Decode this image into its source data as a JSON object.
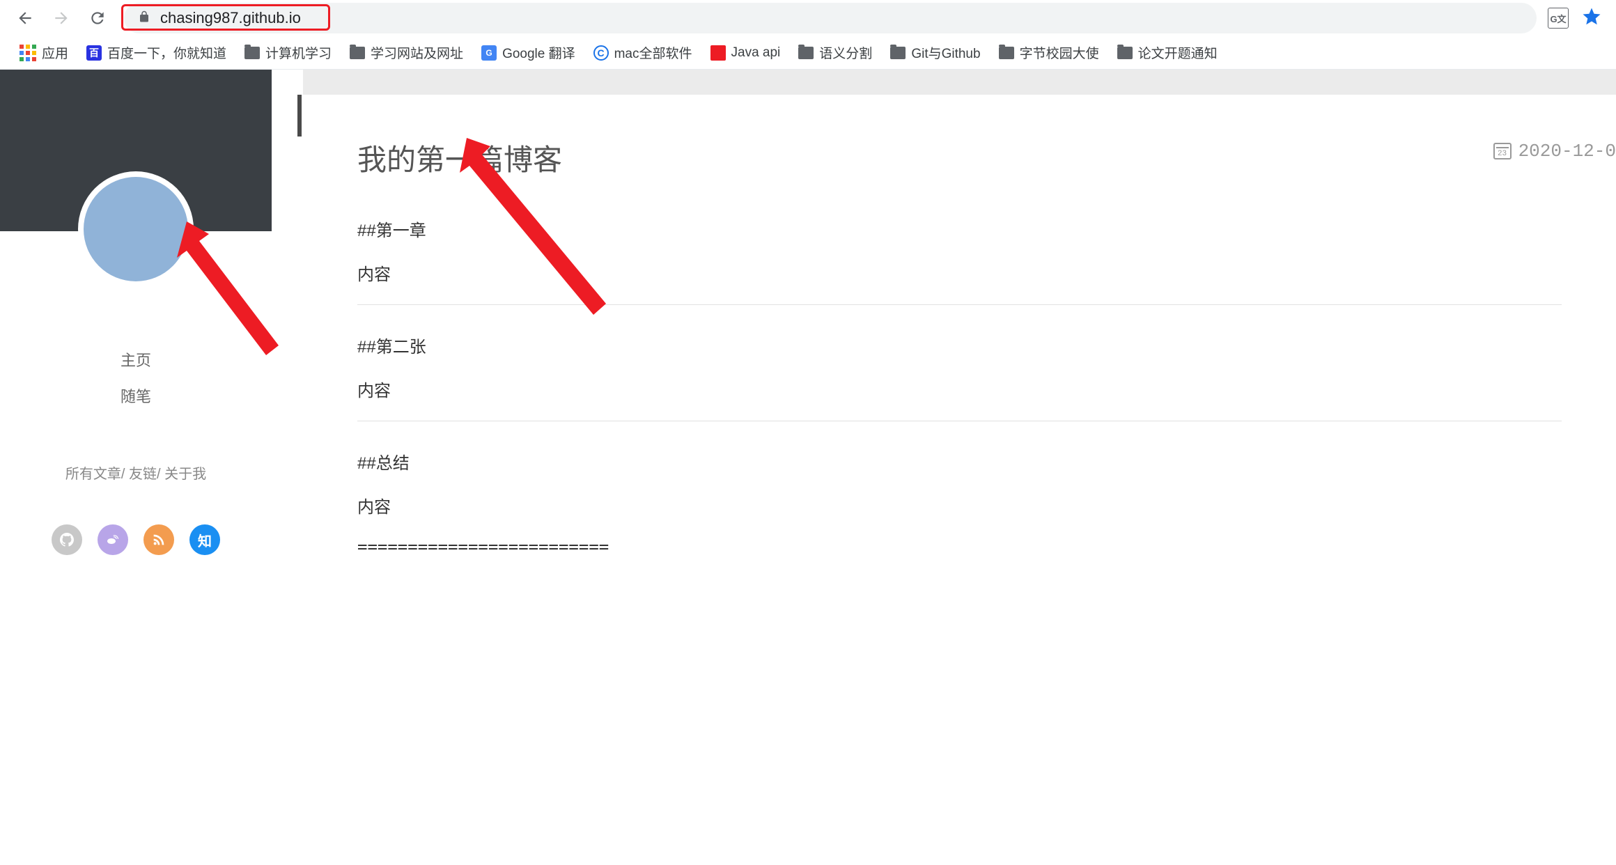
{
  "chrome": {
    "url": "chasing987.github.io",
    "translate_label": "G文",
    "bookmarks": [
      {
        "icon": "apps",
        "label": "应用"
      },
      {
        "icon": "baidu",
        "label": "百度一下，你就知道"
      },
      {
        "icon": "folder",
        "label": "计算机学习"
      },
      {
        "icon": "folder",
        "label": "学习网站及网址"
      },
      {
        "icon": "gt",
        "label": "Google 翻译"
      },
      {
        "icon": "c",
        "label": "mac全部软件"
      },
      {
        "icon": "java",
        "label": "Java api"
      },
      {
        "icon": "folder",
        "label": "语义分割"
      },
      {
        "icon": "folder",
        "label": "Git与Github"
      },
      {
        "icon": "folder",
        "label": "字节校园大使"
      },
      {
        "icon": "folder",
        "label": "论文开题通知"
      }
    ]
  },
  "sidebar": {
    "nav": [
      "主页",
      "随笔"
    ],
    "subnav": {
      "all": "所有文章",
      "links": "友链",
      "about": "关于我",
      "sep": "/ "
    },
    "social_zhihu": "知"
  },
  "article": {
    "title": "我的第一篇博客",
    "date": "2020-12-0",
    "date_day": "23",
    "sections": [
      {
        "type": "heading",
        "text": "##第一章"
      },
      {
        "type": "para",
        "text": "内容"
      },
      {
        "type": "hr"
      },
      {
        "type": "heading",
        "text": "##第二张"
      },
      {
        "type": "para",
        "text": "内容"
      },
      {
        "type": "hr"
      },
      {
        "type": "heading",
        "text": "##总结"
      },
      {
        "type": "para",
        "text": "内容"
      },
      {
        "type": "rule",
        "text": "========================="
      }
    ]
  }
}
